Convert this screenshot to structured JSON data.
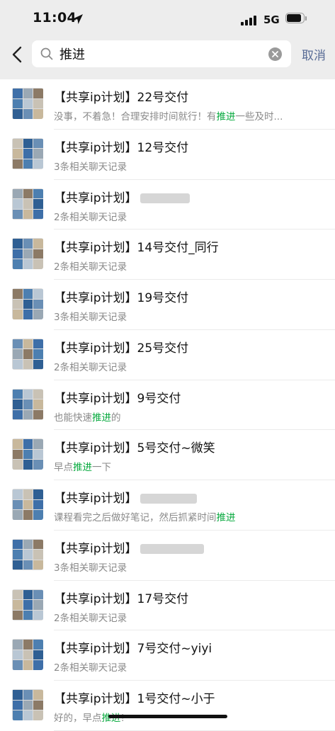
{
  "status_bar": {
    "time": "11:04",
    "network": "5G",
    "battery_level": 0.85
  },
  "search": {
    "query": "推进",
    "cancel_label": "取消"
  },
  "results": [
    {
      "title": "【共享ip计划】22号交付",
      "sub": [
        {
          "t": "没事，不着急！合理安排时间就行！有"
        },
        {
          "t": "推进",
          "hl": true
        },
        {
          "t": "一些及时..."
        }
      ]
    },
    {
      "title": "【共享ip计划】12号交付",
      "sub": [
        {
          "t": "3条相关聊天记录"
        }
      ]
    },
    {
      "title": "【共享ip计划】",
      "blur": 70,
      "sub": [
        {
          "t": "2条相关聊天记录"
        }
      ]
    },
    {
      "title": "【共享ip计划】14号交付_同行",
      "sub": [
        {
          "t": "2条相关聊天记录"
        }
      ]
    },
    {
      "title": "【共享ip计划】19号交付",
      "sub": [
        {
          "t": "3条相关聊天记录"
        }
      ]
    },
    {
      "title": "【共享ip计划】25号交付",
      "sub": [
        {
          "t": "2条相关聊天记录"
        }
      ]
    },
    {
      "title": "【共享ip计划】9号交付",
      "sub": [
        {
          "t": "也能快速"
        },
        {
          "t": "推进",
          "hl": true
        },
        {
          "t": "的"
        }
      ]
    },
    {
      "title": "【共享ip计划】5号交付~微笑",
      "sub": [
        {
          "t": "早点"
        },
        {
          "t": "推进",
          "hl": true
        },
        {
          "t": "一下"
        }
      ]
    },
    {
      "title": "【共享ip计划】",
      "blur": 80,
      "sub": [
        {
          "t": "课程看完之后做好笔记，然后抓紧时间"
        },
        {
          "t": "推进",
          "hl": true
        }
      ]
    },
    {
      "title": "【共享ip计划】",
      "blur": 90,
      "sub": [
        {
          "t": "3条相关聊天记录"
        }
      ]
    },
    {
      "title": "【共享ip计划】17号交付",
      "sub": [
        {
          "t": "2条相关聊天记录"
        }
      ]
    },
    {
      "title": "【共享ip计划】7号交付~yiyi",
      "sub": [
        {
          "t": "2条相关聊天记录"
        }
      ]
    },
    {
      "title": "【共享ip计划】1号交付~小于",
      "sub": [
        {
          "t": "好的，早点"
        },
        {
          "t": "推进",
          "hl": true
        },
        {
          "t": "!"
        }
      ]
    }
  ],
  "colors": {
    "accent": "#576b95",
    "highlight": "#07a93e",
    "header_bg": "#ededed"
  }
}
